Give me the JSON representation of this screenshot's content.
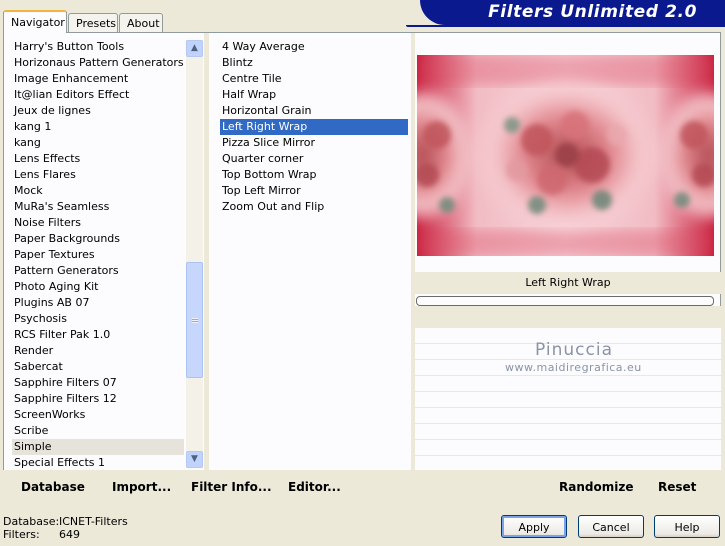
{
  "tabs": [
    {
      "label": "Navigator",
      "active": true
    },
    {
      "label": "Presets",
      "active": false
    },
    {
      "label": "About",
      "active": false
    }
  ],
  "banner": {
    "title": "Filters Unlimited 2.0"
  },
  "categories": {
    "items": [
      "Harry's Button Tools",
      "Horizonaus Pattern Generators",
      "Image Enhancement",
      "It@lian Editors Effect",
      "Jeux de lignes",
      "kang 1",
      "kang",
      "Lens Effects",
      "Lens Flares",
      "Mock",
      "MuRa's Seamless",
      "Noise Filters",
      "Paper Backgrounds",
      "Paper Textures",
      "Pattern Generators",
      "Photo Aging Kit",
      "Plugins AB 07",
      "Psychosis",
      "RCS Filter Pak 1.0",
      "Render",
      "Sabercat",
      "Sapphire Filters 07",
      "Sapphire Filters 12",
      "ScreenWorks",
      "Scribe",
      "Simple",
      "Special Effects 1"
    ],
    "selected": "Simple"
  },
  "filters": {
    "items": [
      "4 Way Average",
      "Blintz",
      "Centre Tile",
      "Half Wrap",
      "Horizontal Grain",
      "Left Right Wrap",
      "Pizza Slice Mirror",
      "Quarter corner",
      "Top Bottom Wrap",
      "Top Left Mirror",
      "Zoom Out and Flip"
    ],
    "selected": "Left Right Wrap"
  },
  "scrollbar": {
    "up_icon": "▲",
    "down_icon": "▼",
    "position_fraction": 0.52
  },
  "toolbar": {
    "database": "Database",
    "import": "Import...",
    "filter_info": "Filter Info...",
    "editor": "Editor...",
    "randomize": "Randomize",
    "reset": "Reset"
  },
  "preview": {
    "filter_name": "Left Right Wrap",
    "watermark_name": "Pinuccia",
    "watermark_url": "www.maidiregrafica.eu"
  },
  "status": {
    "database_label": "Database:",
    "database_value": "ICNET-Filters",
    "filters_label": "Filters:",
    "filters_value": "649"
  },
  "dialog": {
    "apply": "Apply",
    "cancel": "Cancel",
    "help": "Help"
  },
  "colors": {
    "banner": "#0a1a8e",
    "selection": "#316ac5",
    "panel_bg": "#ece9d8"
  }
}
